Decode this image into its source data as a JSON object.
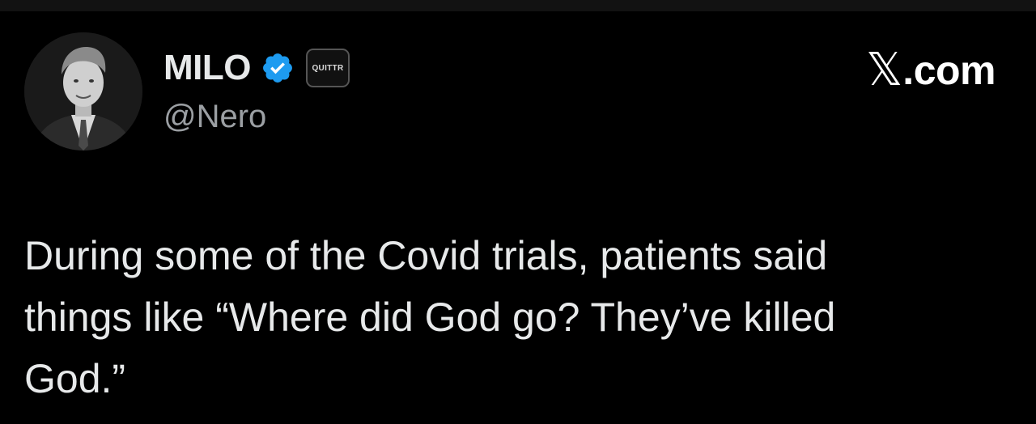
{
  "tweet": {
    "author": {
      "display_name": "MILO",
      "handle": "@Nero",
      "verified": true,
      "verified_icon": "verified-check-icon",
      "verified_color": "#1d9bf0",
      "affiliation_badge": "QUITTR"
    },
    "source": {
      "logo_glyph": "𝕏",
      "text": ".com"
    },
    "body_lines": [
      "During some of the Covid trials, patients said",
      "things like “Where did God go? They’ve killed",
      "God.”"
    ]
  },
  "colors": {
    "background": "#000000",
    "text_primary": "#e7e9ea",
    "text_secondary": "#9b9fa3"
  }
}
